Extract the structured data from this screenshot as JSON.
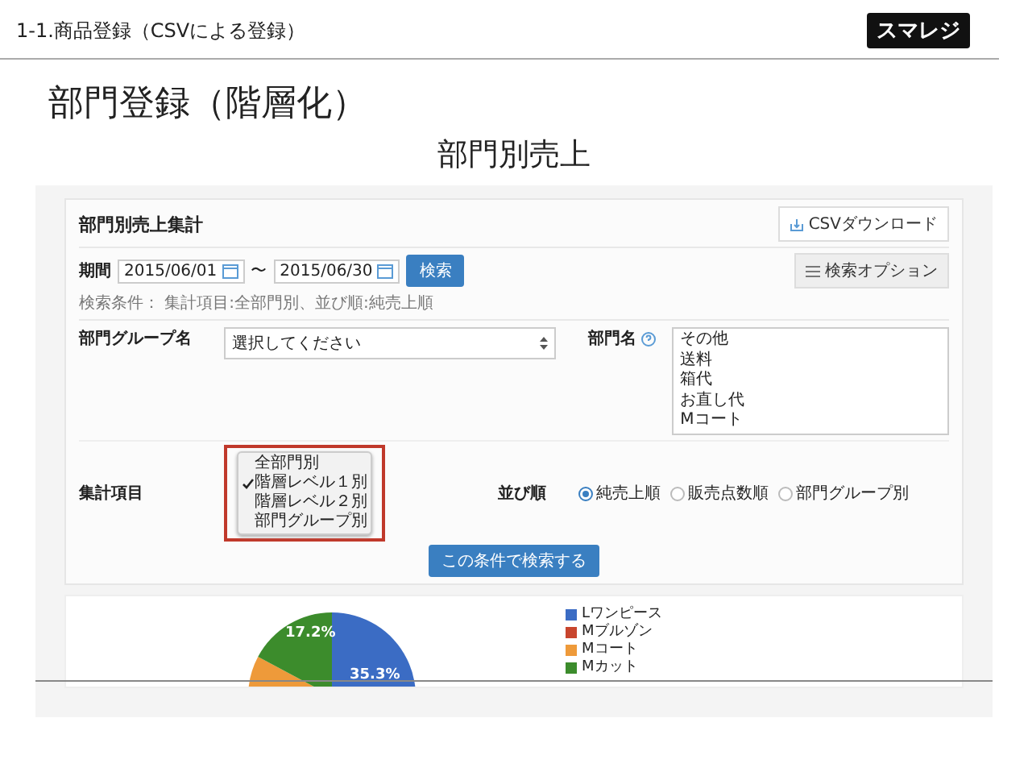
{
  "header": {
    "section": "1-1.商品登録（CSVによる登録）",
    "logo": "スマレジ"
  },
  "title": "部門登録（階層化）",
  "subtitle": "部門別売上",
  "screen": {
    "heading": "部門別売上集計",
    "csv_button": "CSVダウンロード",
    "period_label": "期間",
    "date_from": "2015/06/01",
    "separator": "〜",
    "date_to": "2015/06/30",
    "search_button": "検索",
    "search_options_button": "検索オプション",
    "conditions": "検索条件： 集計項目:全部門別、並び順:純売上順",
    "group_label": "部門グループ名",
    "group_select": "選択してください",
    "dept_label": "部門名",
    "dept_list": [
      "その他",
      "送料",
      "箱代",
      "お直し代",
      "Mコート"
    ],
    "aggregate_label": "集計項目",
    "aggregate_options": [
      {
        "label": "全部門別",
        "selected": false
      },
      {
        "label": "階層レベル１別",
        "selected": true
      },
      {
        "label": "階層レベル２別",
        "selected": false
      },
      {
        "label": "部門グループ別",
        "selected": false
      }
    ],
    "sort_label": "並び順",
    "sort_options": [
      {
        "label": "純売上順",
        "selected": true
      },
      {
        "label": "販売点数順",
        "selected": false
      },
      {
        "label": "部門グループ別",
        "selected": false
      }
    ],
    "submit_button": "この条件で検索する",
    "chart": {
      "slice_labels": [
        "17.2%",
        "35.3%"
      ],
      "legend": [
        {
          "label": "Lワンピース",
          "color": "#3b6cc4"
        },
        {
          "label": "Mブルゾン",
          "color": "#c8452d"
        },
        {
          "label": "Mコート",
          "color": "#ee9a3a"
        },
        {
          "label": "Mカット",
          "color": "#3c8c2c"
        }
      ]
    }
  }
}
